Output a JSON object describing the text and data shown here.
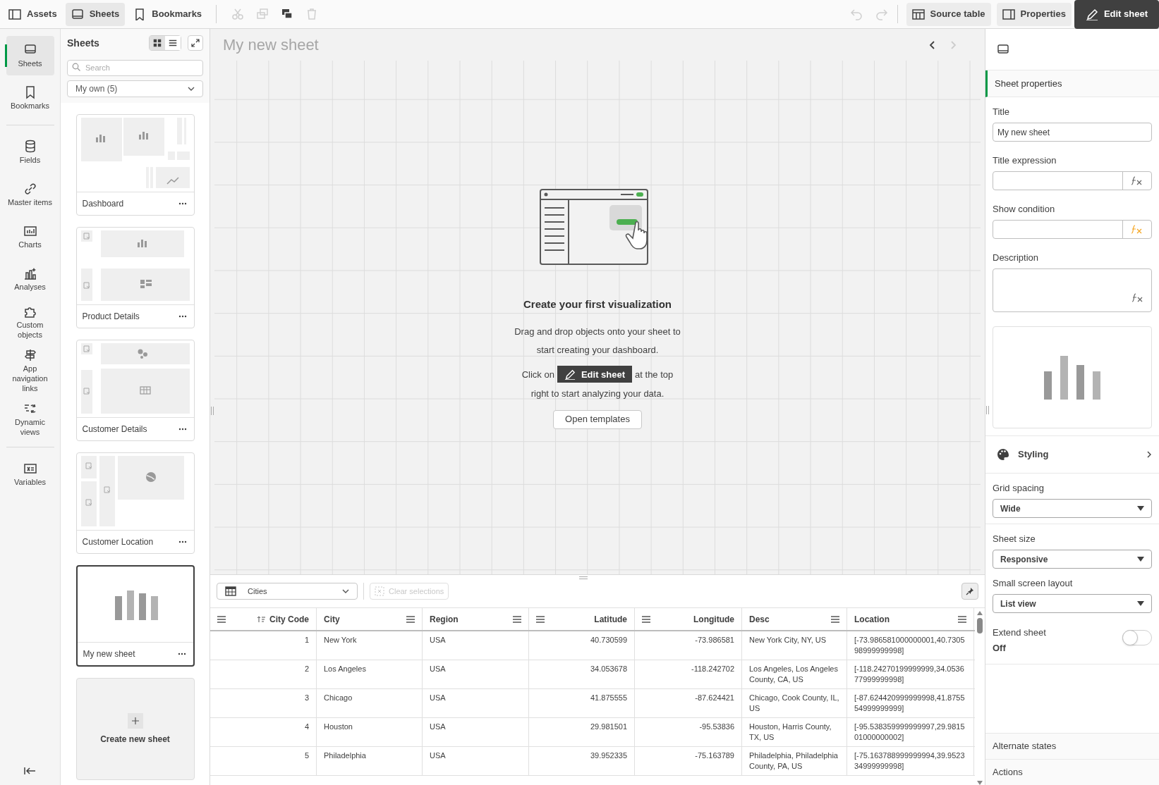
{
  "toolbar": {
    "left": [
      {
        "label": "Assets",
        "selected": false
      },
      {
        "label": "Sheets",
        "selected": true
      },
      {
        "label": "Bookmarks",
        "selected": false
      }
    ],
    "edit_actions": [
      {
        "disabled": true
      },
      {
        "disabled": true
      },
      {
        "disabled": false
      },
      {
        "disabled": true
      }
    ],
    "history": [
      {
        "disabled": true
      },
      {
        "disabled": true
      }
    ],
    "right": [
      {
        "label": "Source table",
        "kind": "toggle"
      },
      {
        "label": "Properties",
        "kind": "toggle"
      },
      {
        "label": "Edit sheet",
        "kind": "primary"
      }
    ]
  },
  "rail": {
    "groups": [
      [
        {
          "label": "Sheets",
          "selected": true
        },
        {
          "label": "Bookmarks",
          "selected": false
        }
      ],
      [
        {
          "label": "Fields",
          "selected": false
        },
        {
          "label": "Master items",
          "selected": false
        },
        {
          "label": "Charts",
          "selected": false
        },
        {
          "label": "Analyses",
          "selected": false
        },
        {
          "label": "Custom objects",
          "selected": false
        },
        {
          "label": "App navigation links",
          "selected": false
        },
        {
          "label": "Dynamic views",
          "selected": false
        }
      ],
      [
        {
          "label": "Variables",
          "selected": false
        }
      ]
    ]
  },
  "sheets_panel": {
    "title": "Sheets",
    "views": [
      {
        "selected": true
      },
      {
        "selected": false
      }
    ],
    "search": {
      "placeholder": "Search"
    },
    "filter": "My own (5)",
    "sheets": [
      {
        "title": "Dashboard",
        "selected": false
      },
      {
        "title": "Product Details",
        "selected": false
      },
      {
        "title": "Customer Details",
        "selected": false
      },
      {
        "title": "Customer Location",
        "selected": false
      },
      {
        "title": "My new sheet",
        "selected": true
      }
    ],
    "create_label": "Create new sheet"
  },
  "canvas": {
    "title": "My new sheet",
    "nav": [
      {
        "disabled": false
      },
      {
        "disabled": true
      }
    ],
    "empty": {
      "heading": "Create your first visualization",
      "text": "Drag and drop objects onto your sheet to start creating your dashboard.",
      "click_prefix": "Click on",
      "button": "Edit sheet",
      "click_suffix": "at the top",
      "click_line2": "right to start analyzing your data.",
      "templates_button": "Open templates"
    }
  },
  "table": {
    "source": "Cities",
    "clear_label": "Clear selections",
    "clear_disabled": true,
    "columns": [
      {
        "label": "City Code",
        "kind": "numeric",
        "sorted": true
      },
      {
        "label": "City",
        "kind": "text",
        "sorted": false
      },
      {
        "label": "Region",
        "kind": "text",
        "sorted": false
      },
      {
        "label": "Latitude",
        "kind": "numeric",
        "sorted": false
      },
      {
        "label": "Longitude",
        "kind": "numeric",
        "sorted": false
      },
      {
        "label": "Desc",
        "kind": "text",
        "sorted": false
      },
      {
        "label": "Location",
        "kind": "text",
        "sorted": false
      }
    ],
    "rows": [
      [
        "1",
        "New York",
        "USA",
        "40.730599",
        "-73.986581",
        "New York City, NY, US",
        "[-73.986581000000001,40.730598999999998]"
      ],
      [
        "2",
        "Los Angeles",
        "USA",
        "34.053678",
        "-118.242702",
        "Los Angeles, Los Angeles County, CA, US",
        "[-118.24270199999999,34.053677999999998]"
      ],
      [
        "3",
        "Chicago",
        "USA",
        "41.875555",
        "-87.624421",
        "Chicago, Cook County, IL, US",
        "[-87.624420999999998,41.875554999999999]"
      ],
      [
        "4",
        "Houston",
        "USA",
        "29.981501",
        "-95.53836",
        "Houston, Harris County, TX, US",
        "[-95.538359999999997,29.981501000000002]"
      ],
      [
        "5",
        "Philadelphia",
        "USA",
        "39.952335",
        "-75.163789",
        "Philadelphia, Philadelphia County, PA, US",
        "[-75.163788999999994,39.952334999999998]"
      ]
    ]
  },
  "properties": {
    "section": "Sheet properties",
    "fields": [
      {
        "kind": "text",
        "label": "Title",
        "value": "My new sheet"
      },
      {
        "kind": "expression",
        "label": "Title expression",
        "highlighted": false
      },
      {
        "kind": "expression",
        "label": "Show condition",
        "highlighted": true
      },
      {
        "kind": "textarea",
        "label": "Description"
      }
    ],
    "styling": "Styling",
    "selects": [
      {
        "label": "Grid spacing",
        "value": "Wide"
      },
      {
        "label": "Sheet size",
        "value": "Responsive"
      },
      {
        "label": "Small screen layout",
        "value": "List view"
      }
    ],
    "toggle": {
      "label": "Extend sheet",
      "state_label": "Off",
      "on": false
    },
    "footer": [
      "Alternate states",
      "Actions"
    ]
  }
}
